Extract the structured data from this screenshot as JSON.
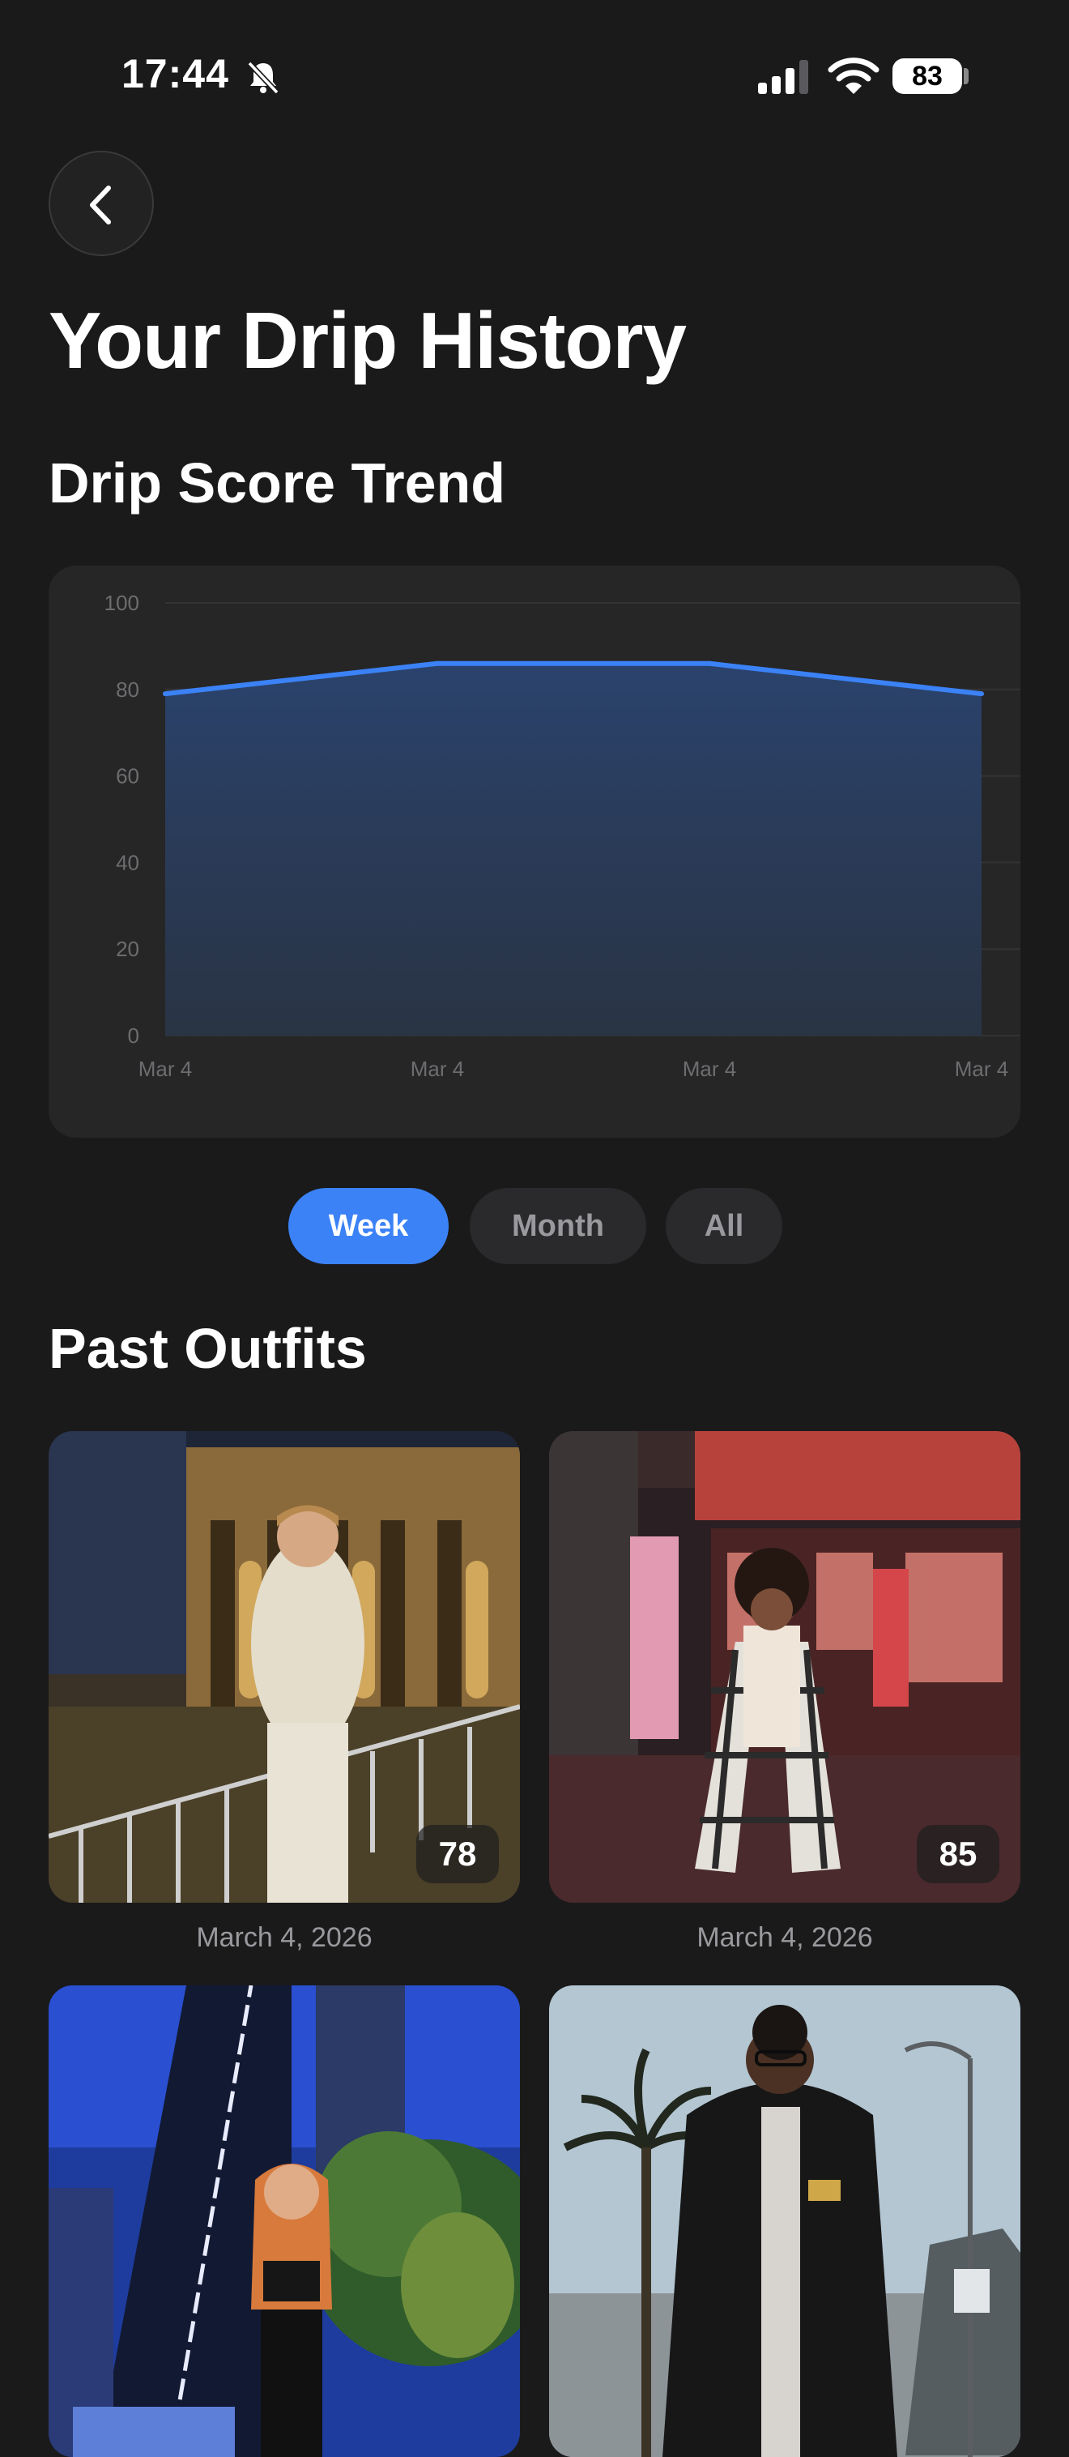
{
  "status_bar": {
    "time": "17:44",
    "battery": "83"
  },
  "page": {
    "title": "Your Drip History"
  },
  "trend": {
    "heading": "Drip Score Trend"
  },
  "chart_data": {
    "type": "area",
    "x": [
      "Mar 4",
      "Mar 4",
      "Mar 4",
      "Mar 4"
    ],
    "values": [
      79,
      86,
      86,
      79
    ],
    "ylim": [
      0,
      100
    ],
    "yticks": [
      0,
      20,
      40,
      60,
      80,
      100
    ],
    "grid": true,
    "colors": {
      "line": "#3b82f6",
      "fill": "#2b4470"
    }
  },
  "filters": [
    {
      "label": "Week",
      "active": true
    },
    {
      "label": "Month",
      "active": false
    },
    {
      "label": "All",
      "active": false
    }
  ],
  "outfits": {
    "heading": "Past Outfits",
    "items": [
      {
        "score": "78",
        "date": "March 4, 2026"
      },
      {
        "score": "85",
        "date": "March 4, 2026"
      },
      {
        "score": "",
        "date": ""
      },
      {
        "score": "",
        "date": ""
      }
    ]
  },
  "colors": {
    "accent": "#3b82f6",
    "background": "#1a1a1b",
    "card": "#262627"
  }
}
